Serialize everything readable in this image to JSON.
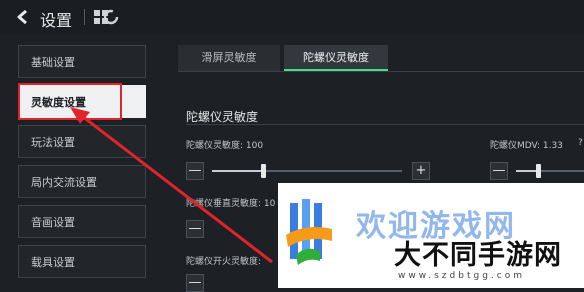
{
  "header": {
    "title": "设置"
  },
  "sidebar": {
    "items": [
      {
        "label": "基础设置"
      },
      {
        "label": "灵敏度设置"
      },
      {
        "label": "玩法设置"
      },
      {
        "label": "局内交流设置"
      },
      {
        "label": "音画设置"
      },
      {
        "label": "载具设置"
      }
    ],
    "active_index": 1
  },
  "tabs": [
    {
      "label": "滑屏灵敏度"
    },
    {
      "label": "陀螺仪灵敏度"
    }
  ],
  "active_tab": 1,
  "section": {
    "title": "陀螺仪灵敏度"
  },
  "settings": {
    "gyro_sensitivity": {
      "label": "陀螺仪灵敏度: 100",
      "level": 0.27
    },
    "gyro_mdv": {
      "label": "陀螺仪MDV: 1.33",
      "help": "?",
      "level": 0.33
    },
    "gyro_vertical": {
      "label": "陀螺仪垂直灵敏度: 10"
    },
    "gyro_fire": {
      "label": "陀螺仪开火灵敏度: "
    }
  },
  "buttons": {
    "minus": "—",
    "plus": "+"
  },
  "watermark": {
    "top_text": "欢迎游戏网",
    "main_text": "大不同手游网",
    "url": "www.szdbtgg.com"
  },
  "colors": {
    "accent": "#3fe08a",
    "highlight": "#e0242b",
    "brand_blue": "#3a7de0",
    "brand_orange": "#f59a1b",
    "brand_green": "#2fae3a"
  },
  "icons": [
    "back-arrow-icon",
    "grid-menu-icon",
    "refresh-icon"
  ]
}
